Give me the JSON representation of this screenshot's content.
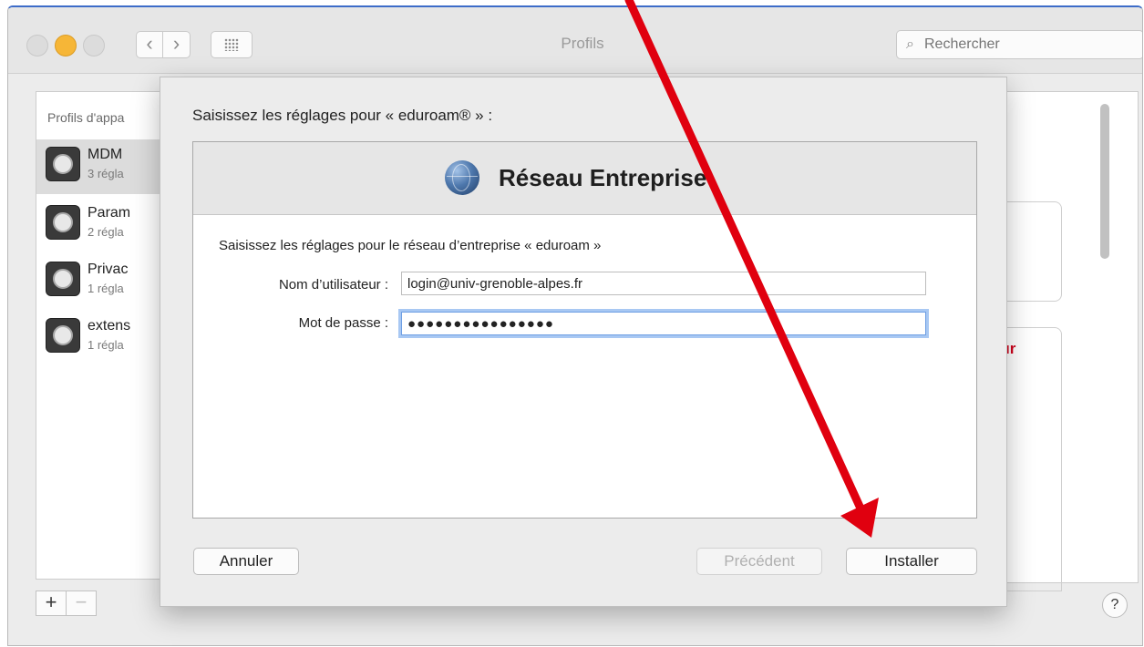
{
  "window": {
    "title": "Profils",
    "search_placeholder": "Rechercher"
  },
  "toolbar": {
    "back_glyph": "‹",
    "forward_glyph": "›"
  },
  "profiles": {
    "header": "Profils d'appa",
    "items": [
      {
        "name": "MDM",
        "count": "3 régla"
      },
      {
        "name": "Param",
        "count": "2 régla"
      },
      {
        "name": "Privac",
        "count": "1 régla"
      },
      {
        "name": "extens",
        "count": "1 régla"
      }
    ],
    "add_label": "+",
    "remove_label": "−"
  },
  "background_right": {
    "red_text": "ır"
  },
  "help": {
    "label": "?"
  },
  "sheet": {
    "prompt": "Saisissez les réglages pour « eduroam® » :",
    "content_title": "Réseau Entreprise",
    "description": "Saisissez les réglages pour le réseau d’entreprise « eduroam »",
    "username_label": "Nom d’utilisateur :",
    "username_value": "login@univ-grenoble-alpes.fr",
    "password_label": "Mot de passe :",
    "password_value": "●●●●●●●●●●●●●●●●",
    "cancel_button": "Annuler",
    "previous_button": "Précédent",
    "install_button": "Installer"
  },
  "icons": {
    "profile_icon": "gear-profile-icon",
    "globe_icon": "globe-icon",
    "search_icon": "search-icon"
  },
  "colors": {
    "accent": "#3d6cc8",
    "arrow_red": "#e0000f",
    "focus_ring": "#a8c8f3"
  }
}
